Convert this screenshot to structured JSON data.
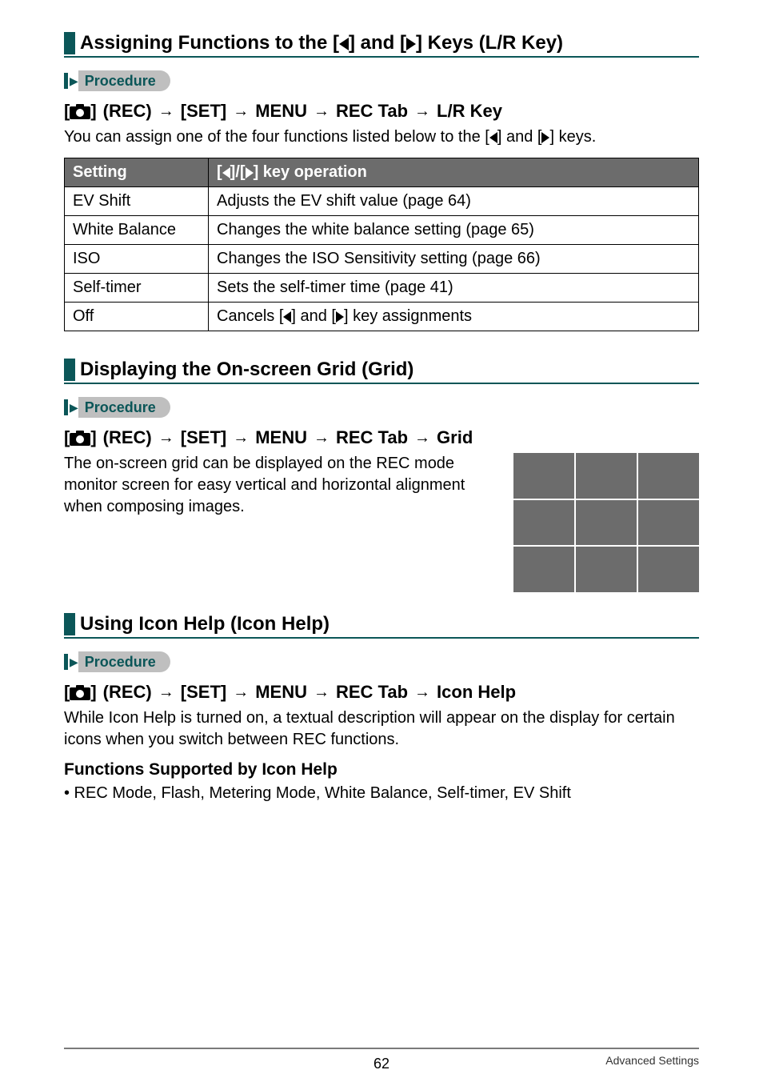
{
  "sections": {
    "lrkey": {
      "title": "Assigning Functions to the [◀] and [▶] Keys (L/R Key)"
    },
    "grid": {
      "title": "Displaying the On-screen Grid (Grid)"
    },
    "iconhelp": {
      "title": "Using Icon Help (Icon Help)"
    }
  },
  "procedure_label": "Procedure",
  "crumb": {
    "rec": "(REC)",
    "set": "[SET]",
    "menu": "MENU",
    "rectab": "REC Tab",
    "lrkey": "L/R Key",
    "grid": "Grid",
    "iconhelp": "Icon Help"
  },
  "lrkey": {
    "intro": "You can assign one of the four functions listed below to the [◀] and [▶] keys.",
    "table": {
      "head_setting": "Setting",
      "head_op": "[◀]/[▶] key operation",
      "rows": [
        {
          "setting": "EV Shift",
          "op": "Adjusts the EV shift value (page 64)"
        },
        {
          "setting": "White Balance",
          "op": "Changes the white balance setting (page 65)"
        },
        {
          "setting": "ISO",
          "op": "Changes the ISO Sensitivity setting (page 66)"
        },
        {
          "setting": "Self-timer",
          "op": "Sets the self-timer time (page 41)"
        },
        {
          "setting": "Off",
          "op": "Cancels [◀] and [▶] key assignments"
        }
      ]
    }
  },
  "grid": {
    "body": "The on-screen grid can be displayed on the REC mode monitor screen for easy vertical and horizontal alignment when composing images."
  },
  "iconhelp": {
    "body": "While Icon Help is turned on, a textual description will appear on the display for certain icons when you switch between REC functions.",
    "sub": "Functions Supported by Icon Help",
    "bullet": "• REC Mode, Flash, Metering Mode, White Balance, Self-timer, EV Shift"
  },
  "footer": {
    "page": "62",
    "right": "Advanced Settings"
  }
}
